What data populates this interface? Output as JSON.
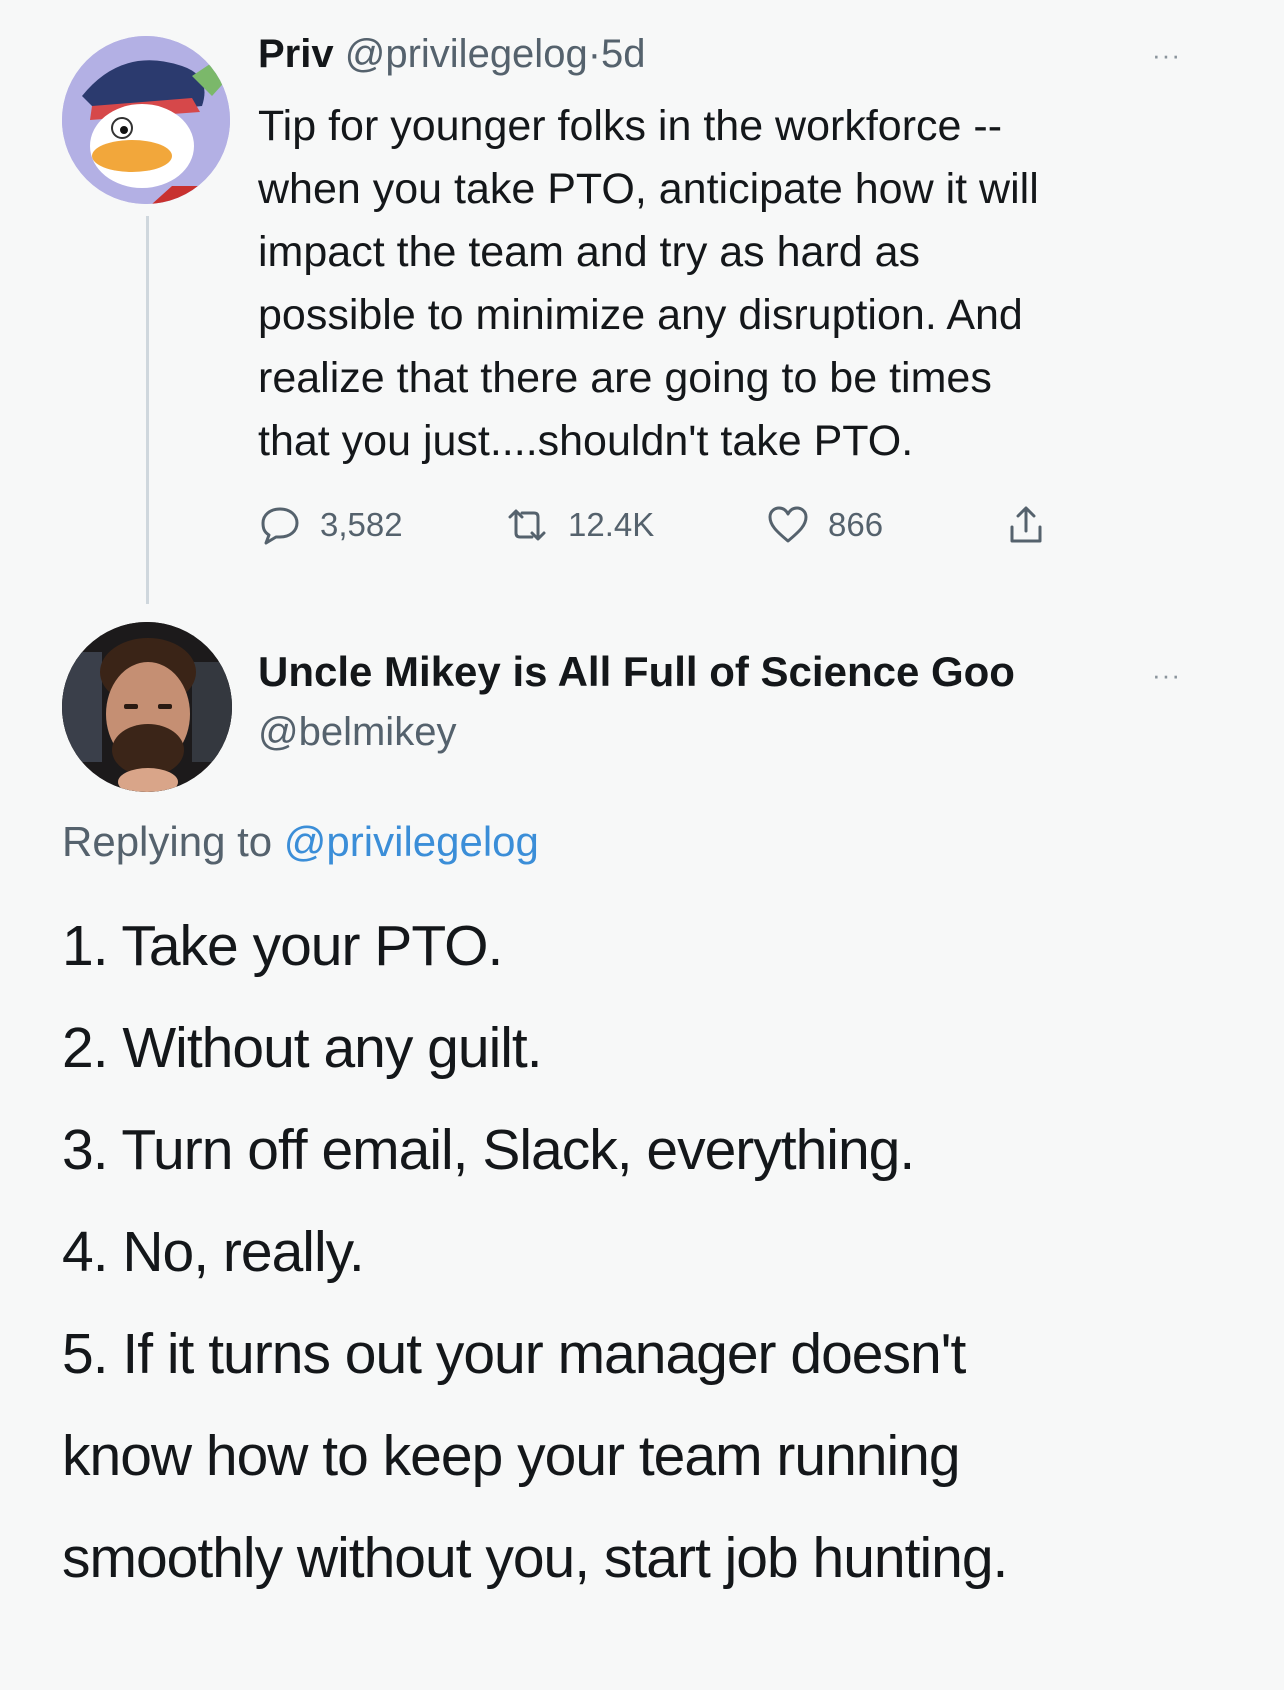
{
  "tweet": {
    "author_name": "Priv",
    "author_handle": "@privilegelog",
    "separator": "·",
    "time": "5d",
    "text_lines": [
      "Tip for younger folks in the workforce --",
      "when you take PTO, anticipate how it will",
      "impact the team and try as hard as",
      "possible to minimize any disruption. And",
      "realize that there are going to be times",
      "that you just....shouldn't take PTO."
    ],
    "stats": {
      "replies": "3,582",
      "retweets": "12.4K",
      "likes": "866"
    },
    "more": "···"
  },
  "reply": {
    "author_name": "Uncle Mikey is All Full of Science Goo",
    "author_handle": "@belmikey",
    "replying_prefix": "Replying to",
    "replying_to": "@privilegelog",
    "more": "···",
    "lines": [
      "1. Take your PTO.",
      "2. Without any guilt.",
      "3. Turn off email, Slack, everything.",
      "4. No, really.",
      "5. If it turns out your manager doesn't",
      "know how to keep your team running",
      "smoothly without you, start job hunting."
    ]
  },
  "colors": {
    "background": "#f7f8f8",
    "text": "#14171a",
    "secondary": "#55626d",
    "link": "#3b8ed8"
  },
  "icons": {
    "reply": "speech-bubble-icon",
    "retweet": "retweet-icon",
    "like": "heart-icon",
    "share": "share-icon"
  }
}
